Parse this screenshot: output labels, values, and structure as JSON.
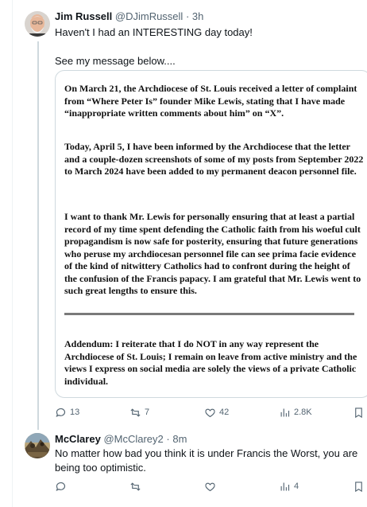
{
  "tweet1": {
    "display_name": "Jim Russell",
    "handle": "@DJimRussell",
    "separator": "·",
    "time": "3h",
    "text": "Haven't I had an INTERESTING day today!\n\nSee my message below....",
    "image_text": {
      "p1": "On March 21, the Archdiocese of St. Louis received a letter of complaint from “Where Peter Is” founder Mike Lewis, stating that I have made “inappropriate written comments about him” on “X”.",
      "p2": "Today, April 5, I have been informed by the Archdiocese that the letter and a couple-dozen screenshots of some of my posts from September 2022 to March 2024 have been added to my permanent deacon personnel file.",
      "p3": "I want to thank Mr. Lewis for personally ensuring that at least a partial record of my time spent defending the Catholic faith from his woeful cult propagandism is now safe for posterity, ensuring that future generations who peruse my archdiocesan personnel file can see prima facie evidence of the kind of nitwittery Catholics had to confront during the height of the confusion of the Francis papacy. I am grateful that Mr. Lewis went to such great lengths to ensure this.",
      "p4": "Addendum: I reiterate that I do NOT in any way represent the Archdiocese of St. Louis; I remain on leave from active ministry and the views I express on social media are solely the views of a private Catholic individual."
    },
    "actions": {
      "replies": "13",
      "reposts": "7",
      "likes": "42",
      "views": "2.8K"
    }
  },
  "tweet2": {
    "display_name": "McClarey",
    "handle": "@McClarey2",
    "separator": "·",
    "time": "8m",
    "text": "No matter how bad you think it is under Francis the Worst, you are being too optimistic.",
    "actions": {
      "views": "4"
    }
  },
  "colors": {
    "text": "#0f1419",
    "muted": "#536471",
    "border": "#cfd9de"
  },
  "icons": [
    "reply-icon",
    "repost-icon",
    "like-icon",
    "views-icon",
    "bookmark-icon"
  ]
}
